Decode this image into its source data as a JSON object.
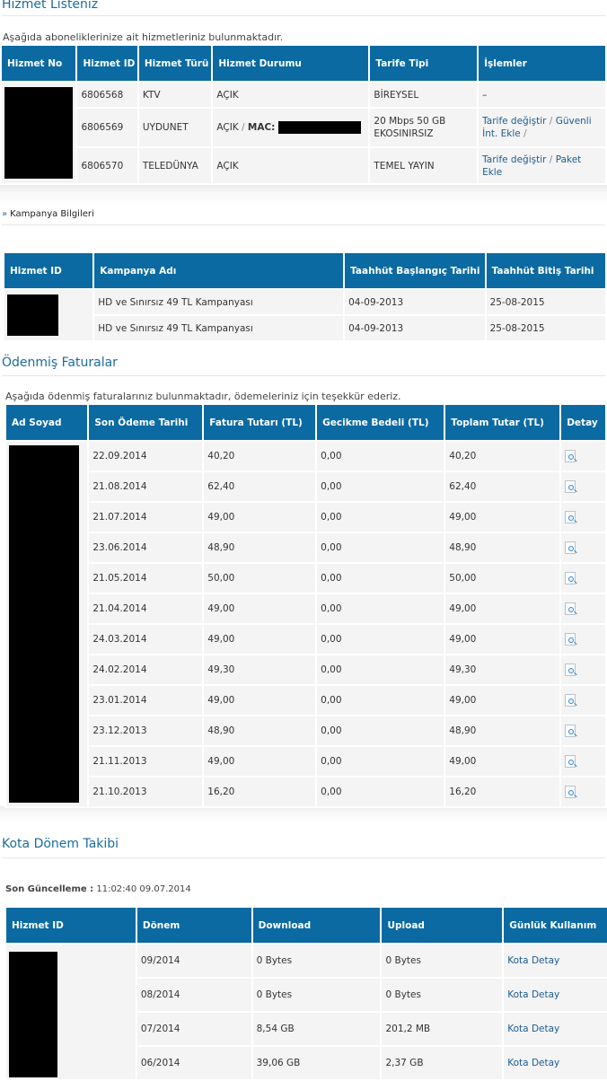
{
  "hizmet": {
    "title": "Hizmet Listeniz",
    "desc": "Aşağıda aboneliklerinize ait hizmetleriniz bulunmaktadır.",
    "headers": [
      "Hizmet No",
      "Hizmet ID",
      "Hizmet Türü",
      "Hizmet Durumu",
      "Tarife Tipi",
      "İşlemler"
    ],
    "rows": [
      {
        "id": "6806568",
        "type": "KTV",
        "status": "AÇIK",
        "tarife": "BİREYSEL",
        "ops": "–"
      },
      {
        "id": "6806569",
        "type": "UYDUNET",
        "status": "AÇIK",
        "status_sep": " / ",
        "mac_label": "MAC:",
        "tarife": "20 Mbps 50 GB EKOSINIRSIZ",
        "op1": "Tarife değiştir",
        "op2": "Güvenli İnt. Ekle",
        "sep": " / "
      },
      {
        "id": "6806570",
        "type": "TELEDÜNYA",
        "status": "AÇIK",
        "tarife": "TEMEL YAYIN",
        "op1": "Tarife değiştir",
        "op2": "Paket Ekle",
        "sep": " / "
      }
    ]
  },
  "kampanya": {
    "link": "Kampanya Bilgileri",
    "arrow": "»",
    "headers": [
      "Hizmet ID",
      "Kampanya Adı",
      "Taahhüt Başlangıç Tarihi",
      "Taahhüt Bitiş Tarihi"
    ],
    "rows": [
      {
        "name": "HD ve Sınırsız 49 TL Kampanyası",
        "start": "04-09-2013",
        "end": "25-08-2015"
      },
      {
        "name": "HD ve Sınırsız 49 TL Kampanyası",
        "start": "04-09-2013",
        "end": "25-08-2015"
      }
    ]
  },
  "faturalar": {
    "title": "Ödenmiş Faturalar",
    "desc": "Aşağıda ödenmiş faturalarınız bulunmaktadır, ödemeleriniz için teşekkür ederiz.",
    "headers": [
      "Ad Soyad",
      "Son Ödeme Tarihi",
      "Fatura Tutarı (TL)",
      "Gecikme Bedeli (TL)",
      "Toplam Tutar (TL)",
      "Detay"
    ],
    "rows": [
      {
        "date": "22.09.2014",
        "amount": "40,20",
        "late": "0,00",
        "total": "40,20"
      },
      {
        "date": "21.08.2014",
        "amount": "62,40",
        "late": "0,00",
        "total": "62,40"
      },
      {
        "date": "21.07.2014",
        "amount": "49,00",
        "late": "0,00",
        "total": "49,00"
      },
      {
        "date": "23.06.2014",
        "amount": "48,90",
        "late": "0,00",
        "total": "48,90"
      },
      {
        "date": "21.05.2014",
        "amount": "50,00",
        "late": "0,00",
        "total": "50,00"
      },
      {
        "date": "21.04.2014",
        "amount": "49,00",
        "late": "0,00",
        "total": "49,00"
      },
      {
        "date": "24.03.2014",
        "amount": "49,00",
        "late": "0,00",
        "total": "49,00"
      },
      {
        "date": "24.02.2014",
        "amount": "49,30",
        "late": "0,00",
        "total": "49,30"
      },
      {
        "date": "23.01.2014",
        "amount": "49,00",
        "late": "0,00",
        "total": "49,00"
      },
      {
        "date": "23.12.2013",
        "amount": "48,90",
        "late": "0,00",
        "total": "48,90"
      },
      {
        "date": "21.11.2013",
        "amount": "49,00",
        "late": "0,00",
        "total": "49,00"
      },
      {
        "date": "21.10.2013",
        "amount": "16,20",
        "late": "0,00",
        "total": "16,20"
      }
    ]
  },
  "kota": {
    "title": "Kota Dönem Takibi",
    "updated_label": "Son Güncelleme :",
    "updated_value": "11:02:40 09.07.2014",
    "headers": [
      "Hizmet ID",
      "Dönem",
      "Download",
      "Upload",
      "Günlük Kullanım"
    ],
    "rows": [
      {
        "period": "09/2014",
        "download": "0 Bytes",
        "upload": "0 Bytes",
        "link": "Kota Detay"
      },
      {
        "period": "08/2014",
        "download": "0 Bytes",
        "upload": "0 Bytes",
        "link": "Kota Detay"
      },
      {
        "period": "07/2014",
        "download": "8,54 GB",
        "upload": "201,2 MB",
        "link": "Kota Detay"
      },
      {
        "period": "06/2014",
        "download": "39,06 GB",
        "upload": "2,37 GB",
        "link": "Kota Detay"
      }
    ]
  },
  "icons": {
    "detail": "document-search-icon",
    "bullet": "double-chevron-right-icon"
  },
  "colors": {
    "header_bg": "#0b6aa1",
    "title": "#1d6c9c",
    "link": "#1d5b91",
    "red": "#d11b1b",
    "cell_bg": "#f4f4f4"
  }
}
